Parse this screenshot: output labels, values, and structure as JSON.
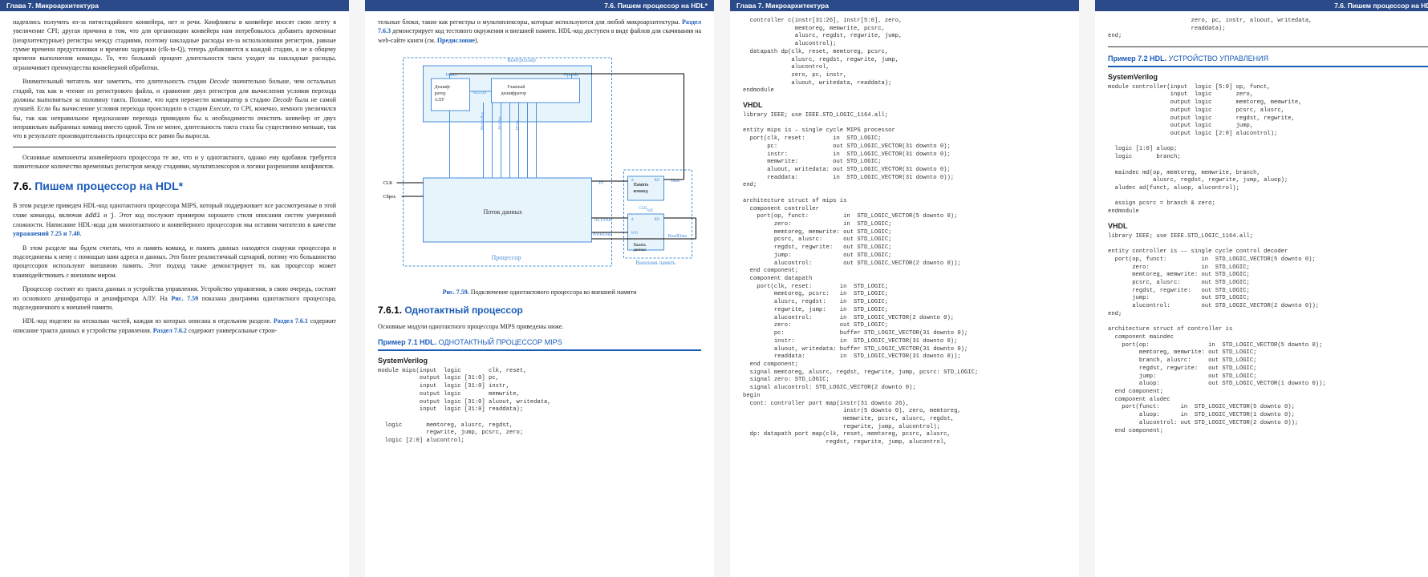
{
  "headers": {
    "left": "Глава 7. Микроархитектура",
    "right": "7.6. Пишем процессор на HDL*"
  },
  "page1": {
    "para1": "надеялись получить из-за пятистадийного конвейера, нет и речи. Конфликты в конвейере вносят свою лепту в увеличение CPI; другая причина в том, что для организации конвейера нам потребовалось добавить временные (неархитектурные) регистры между стадиями, поэтому накладные расходы из-за использования регистров, равные сумме времени предустановки и времени задержки (clk-to-Q), теперь добавляются к каждой стадии, а не к общему времени выполнения команды. То, что больший процент длительности такта уходит на накладные расходы, ограничивает преимущества конвейерной обработки.",
    "para2_a": "Внимательный читатель мог заметить, что длительность стадии ",
    "para2_decode1": "Decode",
    "para2_b": " значительно больше, чем остальных стадий, так как и чтение из регистрового файла, и сравнение двух регистров для вычисления условия перехода должны выполняться за половину такта. Похоже, что идея перенести компаратор в стадию ",
    "para2_decode2": "Decode",
    "para2_c": " была не самой лучшей. Если бы вычисление условия перехода происходило в стадии ",
    "para2_execute": "Execute",
    "para2_d": ", то CPI, конечно, немного увеличился бы, так как неправильное предсказание перехода приводило бы к необходимости очистить конвейер от двух неправильно выбранных команд вместо одной. Тем не менее, длительность такта стала бы существенно меньше, так что в результате производительность процессора все равно бы выросла.",
    "para3": "Основные компоненты конвейерного процессора те же, что и у однотактного, однако ему вдобавок требуется значительное количество временных регистров между стадиями, мультиплексоров и логики разрешения конфликтов.",
    "section_num": "7.6.",
    "section_title": " Пишем процессор на HDL*",
    "para4_a": "В этом разделе приведен HDL-код однотактного процессора MIPS, который поддерживает все рассмотренные в этой главе команды, включая ",
    "para4_addi": "addi",
    "para4_b": " и ",
    "para4_j": "j",
    "para4_c": ". Этот код послужит примером хорошего стиля описания систем умеренной сложности. Написание HDL-кода для многотактного и конвейерного процессоров мы оставим читателю в качестве ",
    "para4_ex": "упражнений 7.25 и 7.40",
    "para4_d": ".",
    "para5": "В этом разделе мы будем считать, что и память команд, и память данных находятся снаружи процессора и подсоединены к нему с помощью шин адреса и данных. Это более реалистичный сценарий, потому что большинство процессоров используют внешнюю память. Этот подход также демонстрирует то, как процессор может взаимодействовать с внешним миром.",
    "para6_a": "Процессор состоит из тракта данных и устройства управления. Устройство управления, в свою очередь, состоит из основного дешифратора и дешифратора АЛУ. На ",
    "para6_fig": "Рис. 7.59",
    "para6_b": " показана диаграмма однотактного процессора, подсоединенного к внешней памяти.",
    "para7_a": "HDL-код поделен на несколько частей, каждая из которых описана в отдельном разделе. ",
    "para7_s1": "Раздел 7.6.1",
    "para7_b": " содержит описание тракта данных и устройства управления. ",
    "para7_s2": "Раздел 7.6.2",
    "para7_c": " содержит универсальные строи-"
  },
  "page2": {
    "para1_a": "тельные блоки, такие как регистры и мультиплексоры, которые используются для любой микроархитектуры. ",
    "para1_link": "Раздел 7.6.3",
    "para1_b": " демонстрирует код тестового окружения и внешней памяти. HDL-код доступен в виде файлов для скачивания на web-сайте книги (см. ",
    "para1_pred": "Предисловие",
    "para1_c": ").",
    "fig_num": "Рис. 7.59.",
    "fig_caption": " Подключение однотактового процессора ко внешней памяти",
    "diagram": {
      "controller": "Контроллер",
      "dec_alu": "Дешиф-\nратор\nАЛУ",
      "main_dec": "Главный\nдешифратор",
      "funct": "Funct",
      "aluop": "ALUOp",
      "opcode": "Opcode",
      "sig1": "MemtoReg",
      "sig3": "ALUSrc",
      "sig5": "PCSrc",
      "clk": "CLK",
      "reset": "Сброс",
      "dataflow": "Поток данных",
      "processor": "Процессор",
      "pc": "PC",
      "instr": "Instr",
      "aluout": "ALUOut",
      "writedata": "WriteData",
      "readdata": "ReadData",
      "imem": "Память\nкоманд",
      "dmem": "Память\nданных",
      "a": "A",
      "rd": "RD",
      "we": "WE",
      "wd": "WD",
      "extmem": "Внешняя память"
    },
    "sub_num": "7.6.1.",
    "sub_title": " Однотактный процессор",
    "modules_text": "Основные модули однотактного процессора MIPS приведены ниже.",
    "example1_label": "Пример 7.1 HDL.",
    "example1_title": " ОДНОТАКТНЫЙ ПРОЦЕССОР MIPS",
    "sv_label": "SystemVerilog",
    "code_sv": "module mips(input  logic        clk, reset,\n            output logic [31:0] pc,\n            input  logic [31:0] instr,\n            output logic        memwrite,\n            output logic [31:0] aluout, writedata,\n            input  logic [31:0] readdata);\n\n  logic       memtoreg, alusrc, regdst,\n              regwrite, jump, pcsrc, zero;\n  logic [2:0] alucontrol;"
  },
  "page3": {
    "code_sv_cont": "  controller c(instr[31:26], instr[5:0], zero,\n               memtoreg, memwrite, pcsrc,\n               alusrc, regdst, regwrite, jump,\n               alucontrol);\n  datapath dp(clk, reset, memtoreg, pcsrc,\n              alusrc, regdst, regwrite, jump,\n              alucontrol,\n              zero, pc, instr,\n              aluout, writedata, readdata);\nendmodule",
    "vhdl_label": "VHDL",
    "code_vhdl": "library IEEE; use IEEE.STD_LOGIC_1164.all;\n\nentity mips is – single cycle MIPS processor\n  port(clk, reset:        in  STD_LOGIC;\n       pc:                out STD_LOGIC_VECTOR(31 downto 0);\n       instr:             in  STD_LOGIC_VECTOR(31 downto 0);\n       memwrite:          out STD_LOGIC;\n       aluout, writedata: out STD_LOGIC_VECTOR(31 downto 0);\n       readdata:          in  STD_LOGIC_VECTOR(31 downto 0));\nend;\n\narchitecture struct of mips is\n  component controller\n    port(op, funct:          in  STD_LOGIC_VECTOR(5 downto 0);\n         zero:               in  STD_LOGIC;\n         memtoreg, memwrite: out STD_LOGIC;\n         pcsrc, alusrc:      out STD_LOGIC;\n         regdst, regwrite:   out STD_LOGIC;\n         jump:               out STD_LOGIC;\n         alucontrol:         out STD_LOGIC_VECTOR(2 downto 0));\n  end component;\n  component datapath\n    port(clk, reset:        in  STD_LOGIC;\n         memtoreg, pcsrc:   in  STD_LOGIC;\n         alusrc, regdst:    in  STD_LOGIC;\n         regwrite, jump:    in  STD_LOGIC;\n         alucontrol:        in  STD_LOGIC_VECTOR(2 downto 0);\n         zero:              out STD_LOGIC;\n         pc:                buffer STD_LOGIC_VECTOR(31 downto 0);\n         instr:             in  STD_LOGIC_VECTOR(31 downto 0);\n         aluout, writedata: buffer STD_LOGIC_VECTOR(31 downto 0);\n         readdata:          in  STD_LOGIC_VECTOR(31 downto 0));\n  end component;\n  signal memtoreg, alusrc, regdst, regwrite, jump, pcsrc: STD_LOGIC;\n  signal zero: STD_LOGIC;\n  signal alucontrol: STD_LOGIC_VECTOR(2 downto 0);\nbegin\n  cont: controller port map(instr(31 downto 26),\n                             instr(5 downto 0), zero, memtoreg,\n                             memwrite, pcsrc, alusrc, regdst,\n                             regwrite, jump, alucontrol);\n  dp: datapath port map(clk, reset, memtoreg, pcsrc, alusrc,\n                        regdst, regwrite, jump, alucontrol,"
  },
  "page4": {
    "code_cont": "                        zero, pc, instr, aluout, writedata,\n                        readdata);\nend;",
    "example2_label": "Пример 7.2 HDL.",
    "example2_title": " УСТРОЙСТВО УПРАВЛЕНИЯ",
    "sv_label": "SystemVerilog",
    "code_sv2": "module controller(input  logic [5:0] op, funct,\n                  input  logic       zero,\n                  output logic       memtoreg, memwrite,\n                  output logic       pcsrc, alusrc,\n                  output logic       regdst, regwrite,\n                  output logic       jump,\n                  output logic [2:0] alucontrol);\n\n  logic [1:0] aluop;\n  logic       branch;\n\n  maindec md(op, memtoreg, memwrite, branch,\n             alusrc, regdst, regwrite, jump, aluop);\n  aludec ad(funct, aluop, alucontrol);\n\n  assign pcsrc = branch & zero;\nendmodule",
    "vhdl_label": "VHDL",
    "code_vhdl2": "library IEEE; use IEEE.STD_LOGIC_1164.all;\n\nentity controller is –– single cycle control decoder\n  port(op, funct:          in  STD_LOGIC_VECTOR(5 downto 0);\n       zero:               in  STD_LOGIC;\n       memtoreg, memwrite: out STD_LOGIC;\n       pcsrc, alusrc:      out STD_LOGIC;\n       regdst, regwrite:   out STD_LOGIC;\n       jump:               out STD_LOGIC;\n       alucontrol:         out STD_LOGIC_VECTOR(2 downto 0));\nend;\n\narchitecture struct of controller is\n  component maindec\n    port(op:                 in  STD_LOGIC_VECTOR(5 downto 0);\n         memtoreg, memwrite: out STD_LOGIC;\n         branch, alusrc:     out STD_LOGIC;\n         regdst, regwrite:   out STD_LOGIC;\n         jump:               out STD_LOGIC;\n         aluop:              out STD_LOGIC_VECTOR(1 downto 0));\n  end component;\n  component aludec\n    port(funct:      in  STD_LOGIC_VECTOR(5 downto 0);\n         aluop:      in  STD_LOGIC_VECTOR(1 downto 0);\n         alucontrol: out STD_LOGIC_VECTOR(2 downto 0));\n  end component;"
  }
}
